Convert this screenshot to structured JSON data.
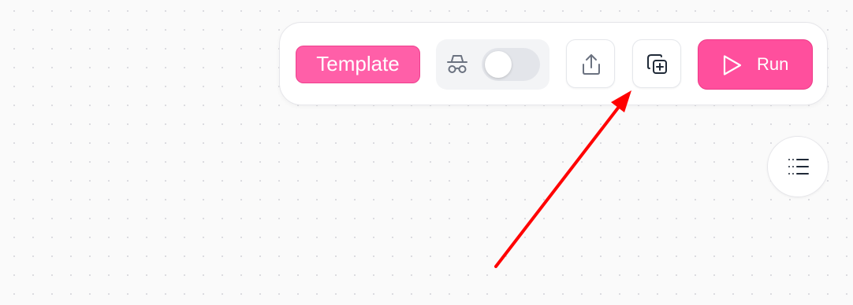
{
  "toolbar": {
    "template_label": "Template",
    "incognito": {
      "icon": "incognito-icon",
      "enabled": false
    },
    "share_icon": "share-icon",
    "duplicate_icon": "duplicate-icon",
    "run": {
      "icon": "play-icon",
      "label": "Run"
    }
  },
  "sidebar_toggle": {
    "icon": "list-icon"
  },
  "annotation": {
    "type": "arrow",
    "color": "#ff0000",
    "points_to": "duplicate-button"
  },
  "colors": {
    "accent": "#ff4f9d",
    "accent_border": "#ee3a88",
    "canvas": "#fafafa",
    "annotation": "#ff0000"
  }
}
